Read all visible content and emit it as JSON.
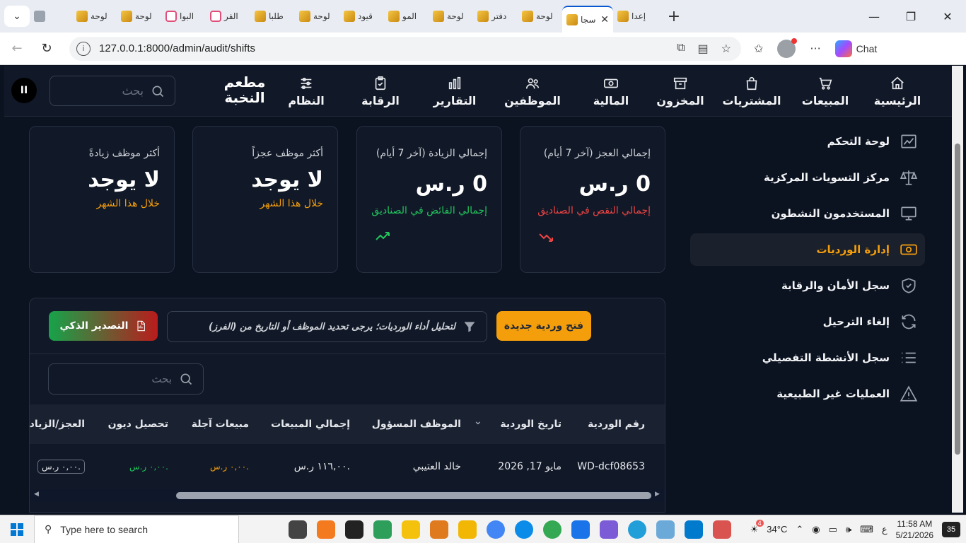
{
  "browser": {
    "tabs": [
      {
        "title": "إعدا",
        "icon": "gold"
      },
      {
        "title": "سجا",
        "icon": "gold",
        "active": true
      },
      {
        "title": "لوحة",
        "icon": "gold"
      },
      {
        "title": "دفتر",
        "icon": "gold"
      },
      {
        "title": "لوحة",
        "icon": "gold"
      },
      {
        "title": "المو",
        "icon": "gold"
      },
      {
        "title": "قيود",
        "icon": "gold"
      },
      {
        "title": "لوحة",
        "icon": "gold"
      },
      {
        "title": "طلبا",
        "icon": "gold"
      },
      {
        "title": "الفر",
        "icon": "pink"
      },
      {
        "title": "البوا",
        "icon": "pink"
      },
      {
        "title": "لوحة",
        "icon": "gold"
      },
      {
        "title": "لوحة",
        "icon": "gold"
      }
    ],
    "url": "127.0.0.1:8000/admin/audit/shifts",
    "chat_label": "Chat"
  },
  "app": {
    "brand": "مطعم النخبة",
    "search_placeholder": "بحث",
    "nav": [
      {
        "key": "home",
        "label": "الرئيسية"
      },
      {
        "key": "sales",
        "label": "المبيعات"
      },
      {
        "key": "purchases",
        "label": "المشتريات"
      },
      {
        "key": "inventory",
        "label": "المخزون"
      },
      {
        "key": "finance",
        "label": "المالية"
      },
      {
        "key": "employees",
        "label": "الموظفين"
      },
      {
        "key": "reports",
        "label": "التقارير"
      },
      {
        "key": "audit",
        "label": "الرقابة"
      },
      {
        "key": "system",
        "label": "النظام"
      }
    ],
    "sidebar": [
      {
        "key": "dashboard",
        "label": "لوحة التحكم"
      },
      {
        "key": "settlements",
        "label": "مركز التسويات المركزية"
      },
      {
        "key": "active-users",
        "label": "المستخدمون النشطون"
      },
      {
        "key": "shifts",
        "label": "إدارة الورديات",
        "active": true
      },
      {
        "key": "security-log",
        "label": "سجل الأمان والرقابة"
      },
      {
        "key": "cancel-posting",
        "label": "إلغاء الترحيل"
      },
      {
        "key": "activity-log",
        "label": "سجل الأنشطة التفصيلي"
      },
      {
        "key": "anomalies",
        "label": "العمليات غير الطبيعية"
      }
    ],
    "cards": [
      {
        "title": "إجمالي العجز (آخر 7 أيام)",
        "value": "0 ر.س",
        "sub": "إجمالي النقص في الصناديق",
        "tone": "red"
      },
      {
        "title": "إجمالي الزيادة (آخر 7 أيام)",
        "value": "0 ر.س",
        "sub": "إجمالي الفائض في الصناديق",
        "tone": "green"
      },
      {
        "title": "أكثر موظف عجزاً",
        "value": "لا يوجد",
        "sub": "خلال هذا الشهر",
        "tone": "orange"
      },
      {
        "title": "أكثر موظف زيادةً",
        "value": "لا يوجد",
        "sub": "خلال هذا الشهر",
        "tone": "orange"
      }
    ],
    "toolbar": {
      "new_shift": "فتح وردية جديدة",
      "filter_hint": "لتحليل أداء الورديات؛ يرجى تحديد الموظف أو التاريخ من (الفرز)",
      "export": "التصدير الذكي",
      "table_search_placeholder": "بحث"
    },
    "table": {
      "headers": [
        "رقم الوردية",
        "تاريخ الوردية",
        "الموظف المسؤول",
        "إجمالي المبيعات",
        "مبيعات آجلة",
        "تحصيل ديون",
        "العجز/الزيادة"
      ],
      "rows": [
        [
          "WD-dcf08653",
          "مايو 17, 2026",
          "خالد العتيبي",
          "١١٦,٠٠ ر.س.",
          "٠,٠٠ ر.س.",
          "٠,٠٠ ر.س.",
          "٠,٠٠ ر.س."
        ]
      ]
    }
  },
  "taskbar": {
    "search_placeholder": "Type here to search",
    "temperature": "34°C",
    "weather_badge": "4",
    "lang": "ع",
    "time": "11:58 AM",
    "date": "5/21/2026",
    "notifications": "35"
  }
}
